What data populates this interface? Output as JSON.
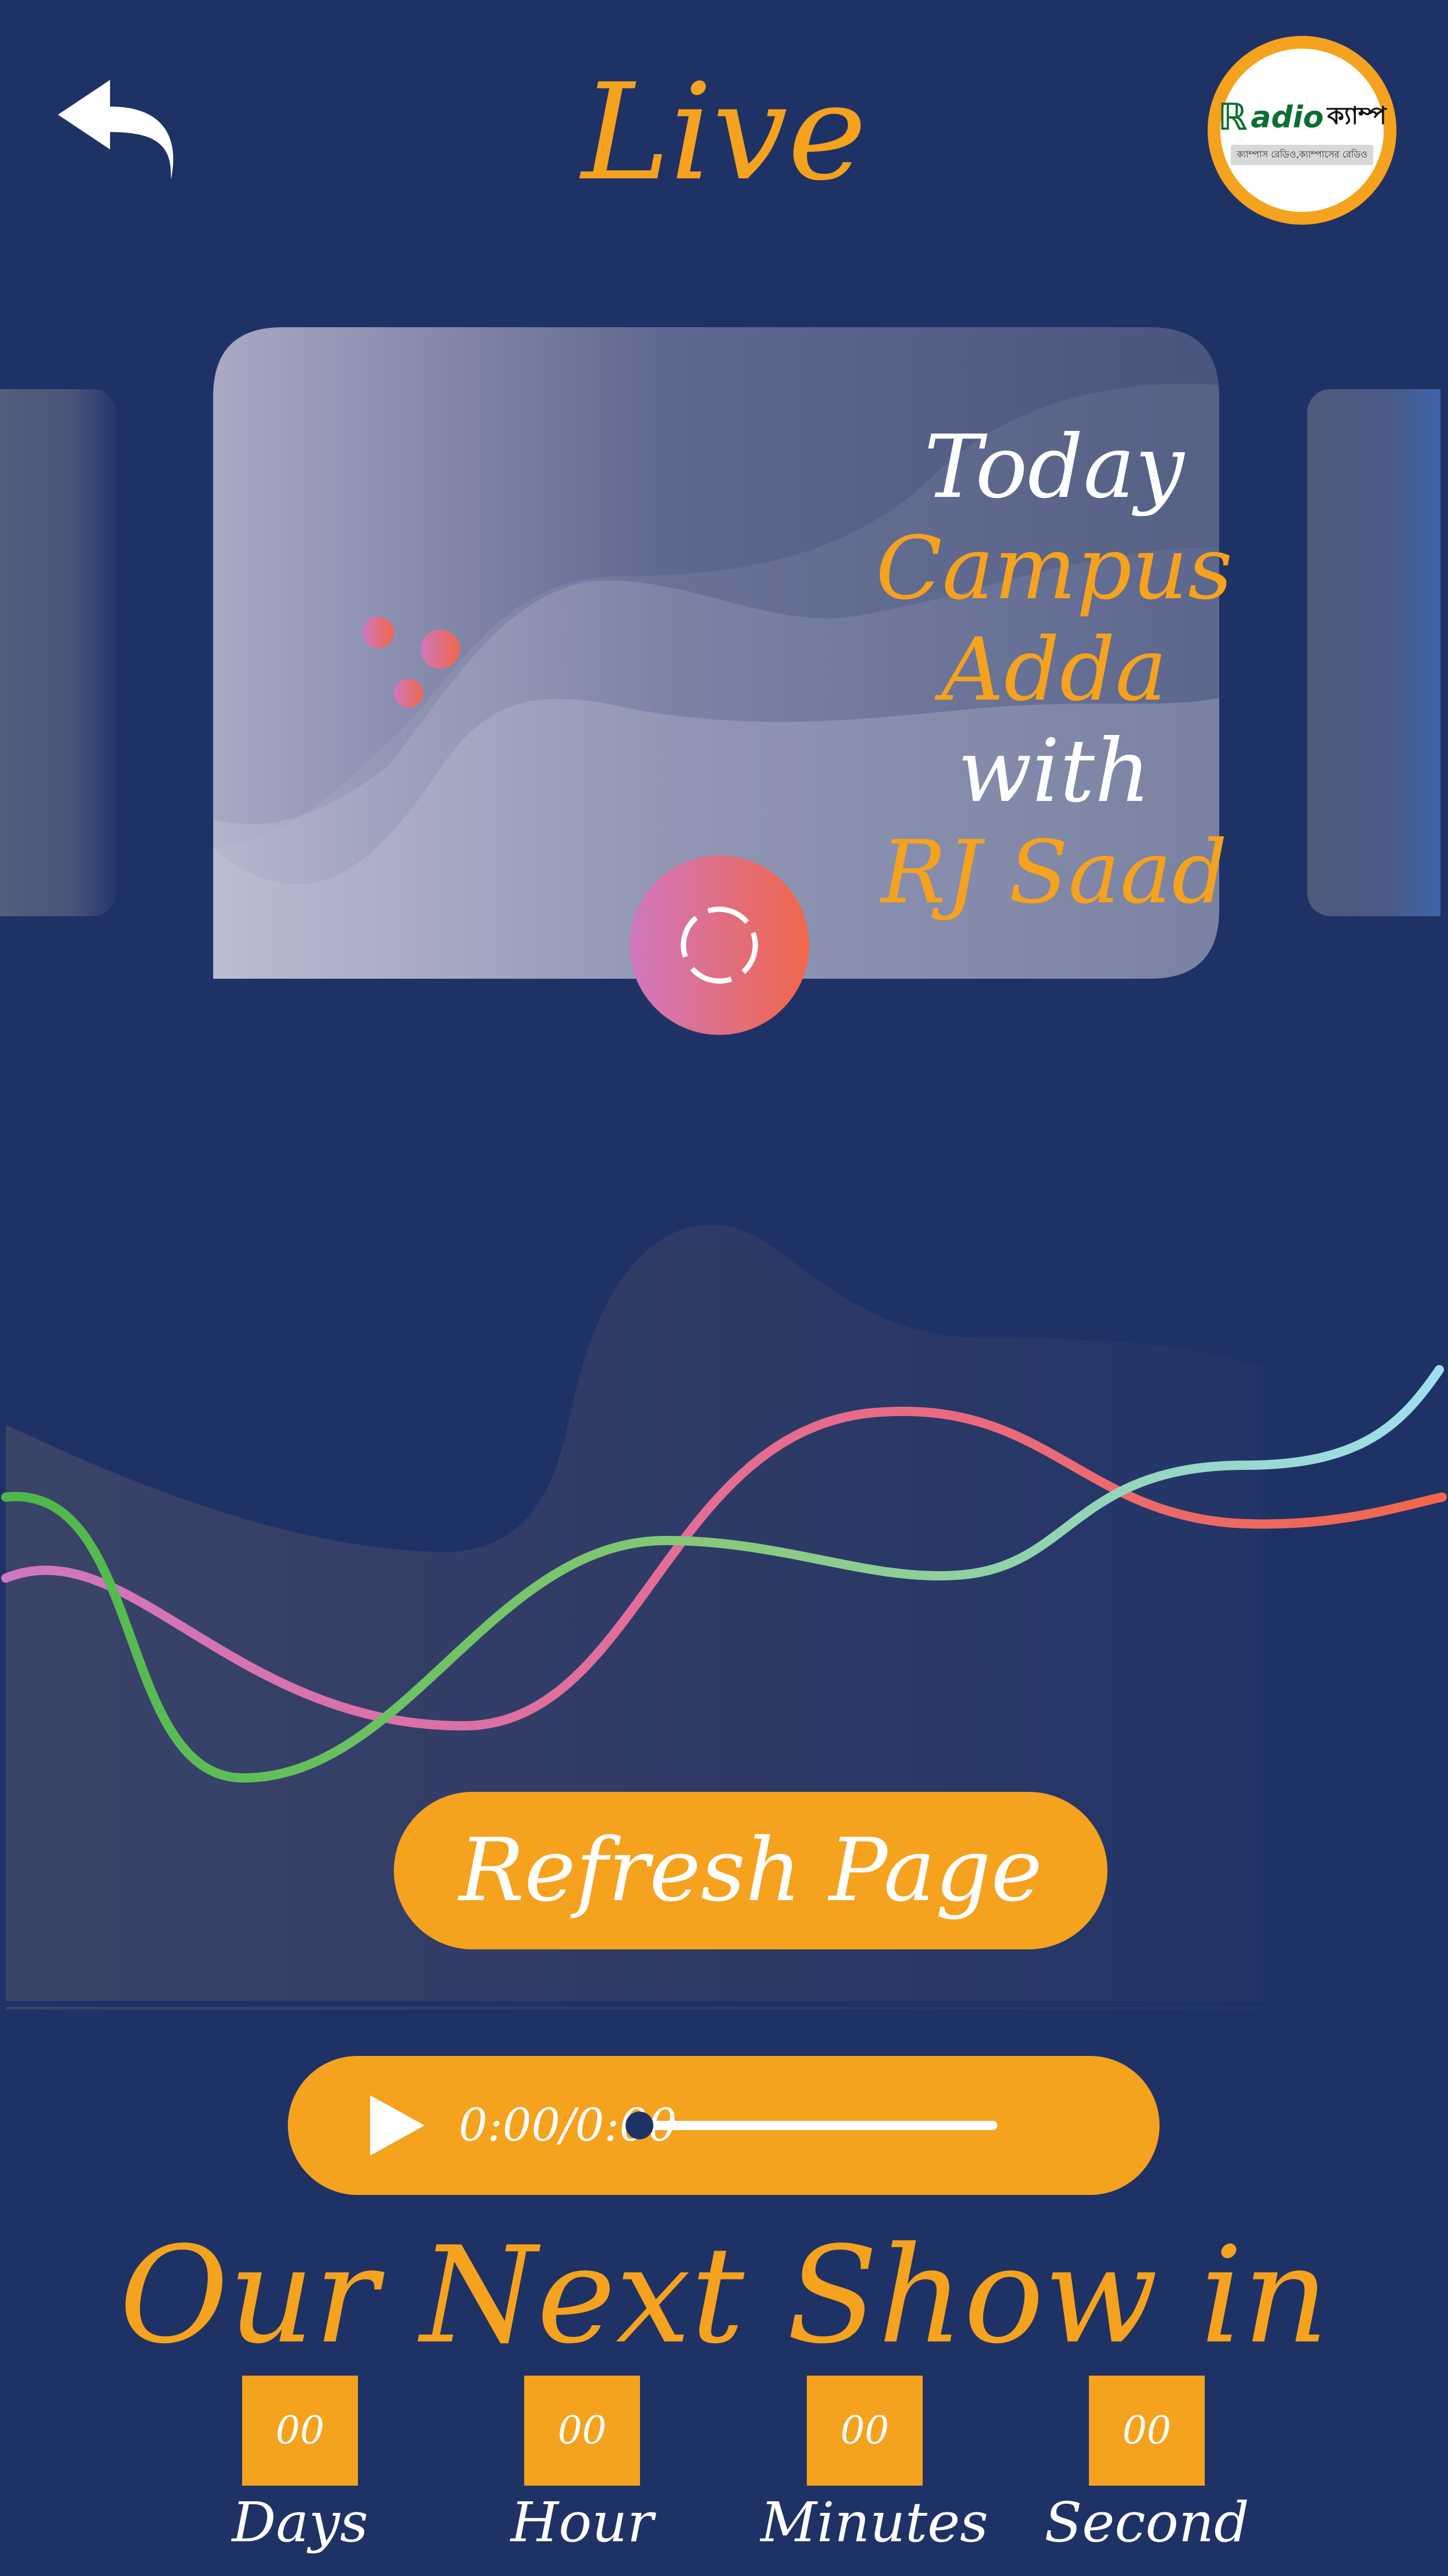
{
  "header": {
    "title": "Live",
    "back_icon": "back-arrow-icon",
    "logo": {
      "text_en": "adio",
      "text_bn": "ক্যাম্পাস রেডিও,ক্যাম্পাসের রেডিও",
      "word_bn": "ক্যাম্প"
    }
  },
  "featured_show": {
    "line1": "Today",
    "show_name": "Campus Adda",
    "line3": "with",
    "host": "RJ Saad",
    "play_icon": "loading-spinner-icon"
  },
  "actions": {
    "refresh_label": "Refresh Page"
  },
  "player": {
    "time": "0:00/0:00",
    "progress": 0,
    "play_icon": "play-icon"
  },
  "next_show": {
    "title": "Our Next Show in",
    "countdown": [
      {
        "value": "00",
        "label": "Days"
      },
      {
        "value": "00",
        "label": "Hour"
      },
      {
        "value": "00",
        "label": "Minutes"
      },
      {
        "value": "00",
        "label": "Second"
      }
    ]
  },
  "colors": {
    "background": "#1f3265",
    "accent": "#f5a21f",
    "text": "#ffffff",
    "gradient_pink": "#cf77c0",
    "gradient_orange": "#f0674a"
  }
}
